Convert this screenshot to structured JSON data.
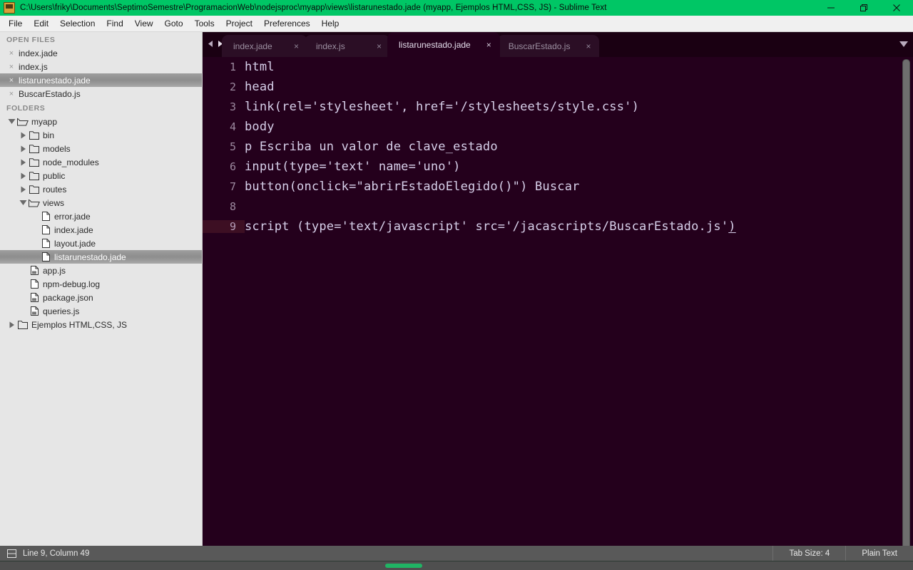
{
  "window": {
    "title": "C:\\Users\\friky\\Documents\\SeptimoSemestre\\ProgramacionWeb\\nodejsproc\\myapp\\views\\listarunestado.jade (myapp, Ejemplos HTML,CSS, JS) - Sublime Text",
    "app_icon": "sublime-text-icon",
    "titlebar_color": "#00c665",
    "minimize_label": "─",
    "maximize_label": "❐",
    "close_label": "✕"
  },
  "menubar": {
    "items": [
      {
        "label": "File"
      },
      {
        "label": "Edit"
      },
      {
        "label": "Selection"
      },
      {
        "label": "Find"
      },
      {
        "label": "View"
      },
      {
        "label": "Goto"
      },
      {
        "label": "Tools"
      },
      {
        "label": "Project"
      },
      {
        "label": "Preferences"
      },
      {
        "label": "Help"
      }
    ]
  },
  "sidebar": {
    "open_files_header": "OPEN FILES",
    "open_files": [
      {
        "label": "index.jade",
        "selected": false
      },
      {
        "label": "index.js",
        "selected": false
      },
      {
        "label": "listarunestado.jade",
        "selected": true
      },
      {
        "label": "BuscarEstado.js",
        "selected": false
      }
    ],
    "folders_header": "FOLDERS",
    "tree": [
      {
        "label": "myapp",
        "kind": "folder-open",
        "expanded": true,
        "depth": 0,
        "selected": false
      },
      {
        "label": "bin",
        "kind": "folder",
        "expanded": false,
        "depth": 1,
        "selected": false
      },
      {
        "label": "models",
        "kind": "folder",
        "expanded": false,
        "depth": 1,
        "selected": false
      },
      {
        "label": "node_modules",
        "kind": "folder",
        "expanded": false,
        "depth": 1,
        "selected": false
      },
      {
        "label": "public",
        "kind": "folder",
        "expanded": false,
        "depth": 1,
        "selected": false
      },
      {
        "label": "routes",
        "kind": "folder",
        "expanded": false,
        "depth": 1,
        "selected": false
      },
      {
        "label": "views",
        "kind": "folder-open",
        "expanded": true,
        "depth": 1,
        "selected": false
      },
      {
        "label": "error.jade",
        "kind": "file",
        "depth": 2,
        "selected": false
      },
      {
        "label": "index.jade",
        "kind": "file",
        "depth": 2,
        "selected": false
      },
      {
        "label": "layout.jade",
        "kind": "file",
        "depth": 2,
        "selected": false
      },
      {
        "label": "listarunestado.jade",
        "kind": "file",
        "depth": 2,
        "selected": true
      },
      {
        "label": "app.js",
        "kind": "file-code",
        "depth": 1,
        "selected": false
      },
      {
        "label": "npm-debug.log",
        "kind": "file",
        "depth": 1,
        "selected": false
      },
      {
        "label": "package.json",
        "kind": "file-code",
        "depth": 1,
        "selected": false
      },
      {
        "label": "queries.js",
        "kind": "file-code",
        "depth": 1,
        "selected": false
      },
      {
        "label": "Ejemplos HTML,CSS, JS",
        "kind": "folder",
        "expanded": false,
        "depth": 0,
        "selected": false
      }
    ]
  },
  "tabbar": {
    "prev_icon": "chevron-left-icon",
    "next_icon": "chevron-right-icon",
    "overflow_icon": "chevron-down-icon",
    "close_glyph": "×",
    "tabs": [
      {
        "label": "index.jade",
        "active": false
      },
      {
        "label": "index.js",
        "active": false
      },
      {
        "label": "listarunestado.jade",
        "active": true
      },
      {
        "label": "BuscarEstado.js",
        "active": false
      }
    ]
  },
  "editor": {
    "background": "#24001c",
    "text_color": "#d7d0ea",
    "current_line": 9,
    "lines": [
      {
        "num": "1",
        "text": "html"
      },
      {
        "num": "2",
        "text": "head"
      },
      {
        "num": "3",
        "text": "link(rel='stylesheet', href='/stylesheets/style.css')"
      },
      {
        "num": "4",
        "text": "body"
      },
      {
        "num": "5",
        "text": "p Escriba un valor de clave_estado"
      },
      {
        "num": "6",
        "text": "input(type='text' name='uno')"
      },
      {
        "num": "7",
        "text": "button(onclick=\"abrirEstadoElegido()\") Buscar"
      },
      {
        "num": "8",
        "text": ""
      },
      {
        "num": "9",
        "text": "script (type='text/javascript' src='/jacascripts/BuscarEstado.js')"
      }
    ]
  },
  "statusbar": {
    "panel_icon": "side-panel-icon",
    "position": "Line 9, Column 49",
    "tab_size": "Tab Size: 4",
    "syntax": "Plain Text"
  }
}
